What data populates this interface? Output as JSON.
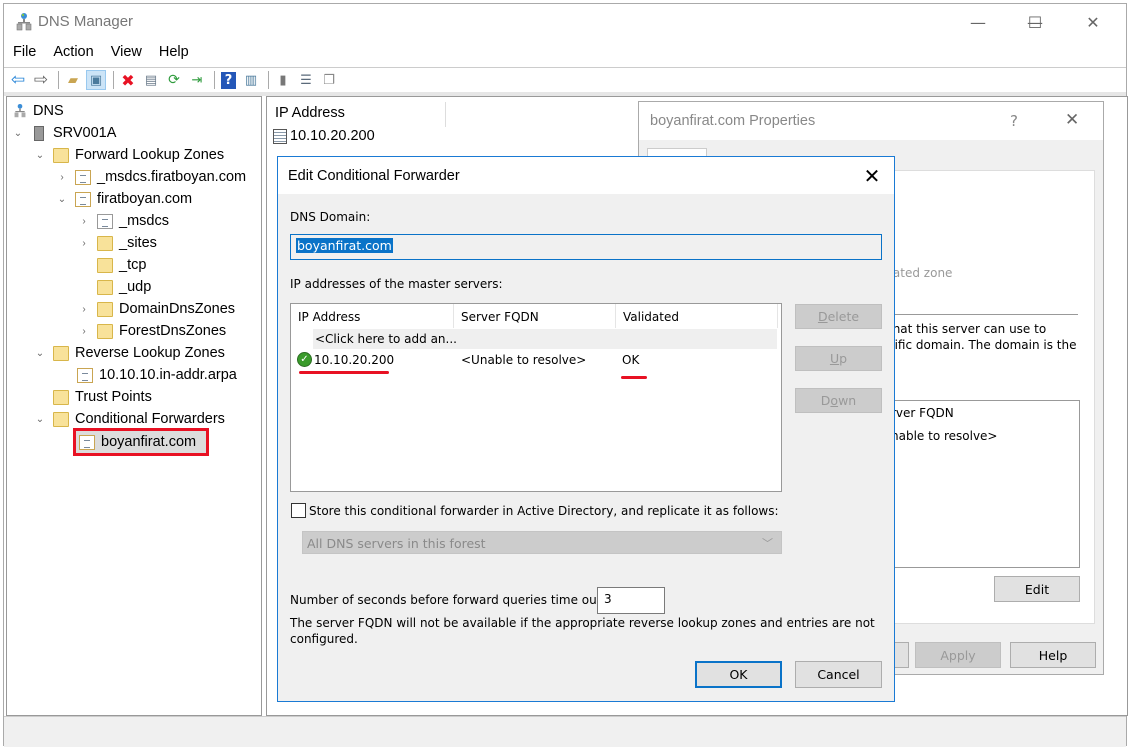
{
  "window": {
    "title": "DNS Manager",
    "controls": {
      "minimize": "—",
      "maximize": "☐",
      "close": "✕"
    }
  },
  "menu": [
    "File",
    "Action",
    "View",
    "Help"
  ],
  "toolbar": [
    {
      "icon": "back-arrow-icon",
      "glyph": "⇦"
    },
    {
      "icon": "forward-arrow-icon",
      "glyph": "⇨"
    },
    {
      "icon": "up-folder-icon",
      "glyph": "📂"
    },
    {
      "icon": "show-hide-console-tree-icon",
      "glyph": "▣"
    },
    {
      "icon": "delete-icon",
      "glyph": "✖"
    },
    {
      "icon": "properties-icon",
      "glyph": "▤"
    },
    {
      "icon": "refresh-icon",
      "glyph": "⟳"
    },
    {
      "icon": "export-list-icon",
      "glyph": "⇥"
    },
    {
      "icon": "help-icon",
      "glyph": "?"
    },
    {
      "icon": "show-action-pane-icon",
      "glyph": "▥"
    },
    {
      "icon": "server-icon",
      "glyph": "▮"
    },
    {
      "icon": "zone-list-icon",
      "glyph": "☰"
    },
    {
      "icon": "copy-icon",
      "glyph": "❐"
    }
  ],
  "tree": {
    "root": "DNS",
    "server": "SRV001A",
    "forward_lookup_zones": "Forward Lookup Zones",
    "msdcs_zone": "_msdcs.firatboyan.com",
    "firatboyan_zone": "firatboyan.com",
    "msdcs": "_msdcs",
    "sites": "_sites",
    "tcp": "_tcp",
    "udp": "_udp",
    "domain_dns_zones": "DomainDnsZones",
    "forest_dns_zones": "ForestDnsZones",
    "reverse_lookup_zones": "Reverse Lookup Zones",
    "reverse_zone": "10.10.10.in-addr.arpa",
    "trust_points": "Trust Points",
    "conditional_forwarders": "Conditional Forwarders",
    "selected_forwarder": "boyanfirat.com"
  },
  "details": {
    "column_header": "IP Address",
    "items": [
      "10.10.20.200"
    ]
  },
  "properties_dialog": {
    "title": "boyanfirat.com Properties",
    "help_glyph": "?",
    "close_glyph": "✕",
    "text_integrated": "rated zone",
    "text_desc_1": "that this server can use to",
    "text_desc_2": "cific domain.  The domain is the",
    "col_server_fqdn": "rver FQDN",
    "cell_unable": "nable to resolve>",
    "edit_label": "Edit",
    "apply_label": "Apply",
    "help_label": "Help"
  },
  "edit_dialog": {
    "title": "Edit Conditional Forwarder",
    "close_glyph": "✕",
    "dns_domain_label": "DNS Domain:",
    "dns_domain_value": "boyanfirat.com",
    "master_servers_label": "IP addresses of the master servers:",
    "columns": [
      "IP Address",
      "Server FQDN",
      "Validated"
    ],
    "add_row_text": "<Click here to add an...",
    "rows": [
      {
        "ip": "10.10.20.200",
        "fqdn": "<Unable to resolve>",
        "validated": "OK",
        "status_icon": "check-ok-icon"
      }
    ],
    "delete_label_u": "D",
    "delete_label_rest": "elete",
    "up_label_u": "U",
    "up_label_rest": "p",
    "down_label_pre": "D",
    "down_label_u": "o",
    "down_label_rest": "wn",
    "store_ad_label": "Store this conditional forwarder in Active Directory, and replicate it as follows:",
    "store_ad_checked": false,
    "replication_scope": "All DNS servers in this forest",
    "timeout_label": "Number of seconds before forward queries time out:",
    "timeout_value": "3",
    "note_line1": "The server FQDN will not be available if the appropriate reverse lookup zones and entries are not",
    "note_line2": "configured.",
    "ok_label": "OK",
    "cancel_label": "Cancel"
  },
  "colors": {
    "accent_blue": "#0a73c8",
    "annotation_red": "#e81123",
    "ok_green": "#3a9b2b"
  }
}
